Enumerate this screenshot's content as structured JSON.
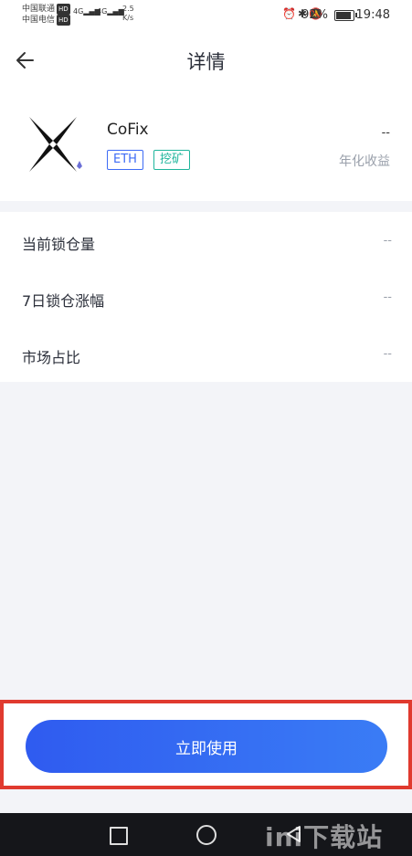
{
  "status_bar": {
    "carrier_1": "中国联通",
    "carrier_2": "中国电信",
    "hd_badge": "HD",
    "net_type": "4G",
    "speed_value": "2.5",
    "speed_unit": "K/s",
    "battery_percent": "92%",
    "time": "19:48"
  },
  "header": {
    "title": "详情",
    "back_icon": "arrow-left-icon"
  },
  "product": {
    "name": "CoFix",
    "logo_text": "COFIX",
    "tags": [
      "ETH",
      "挖矿"
    ],
    "annual_yield_value": "--",
    "annual_yield_label": "年化收益"
  },
  "stats": [
    {
      "label": "当前锁仓量",
      "value": "--"
    },
    {
      "label": "7日锁仓涨幅",
      "value": "--"
    },
    {
      "label": "市场占比",
      "value": "--"
    }
  ],
  "action": {
    "use_label": "立即使用"
  },
  "watermark": "ini下载站",
  "colors": {
    "primary": "#3366f2",
    "tag_eth": "#3d6bf5",
    "tag_mine": "#1fb59c",
    "highlight_border": "#e03a2f"
  }
}
